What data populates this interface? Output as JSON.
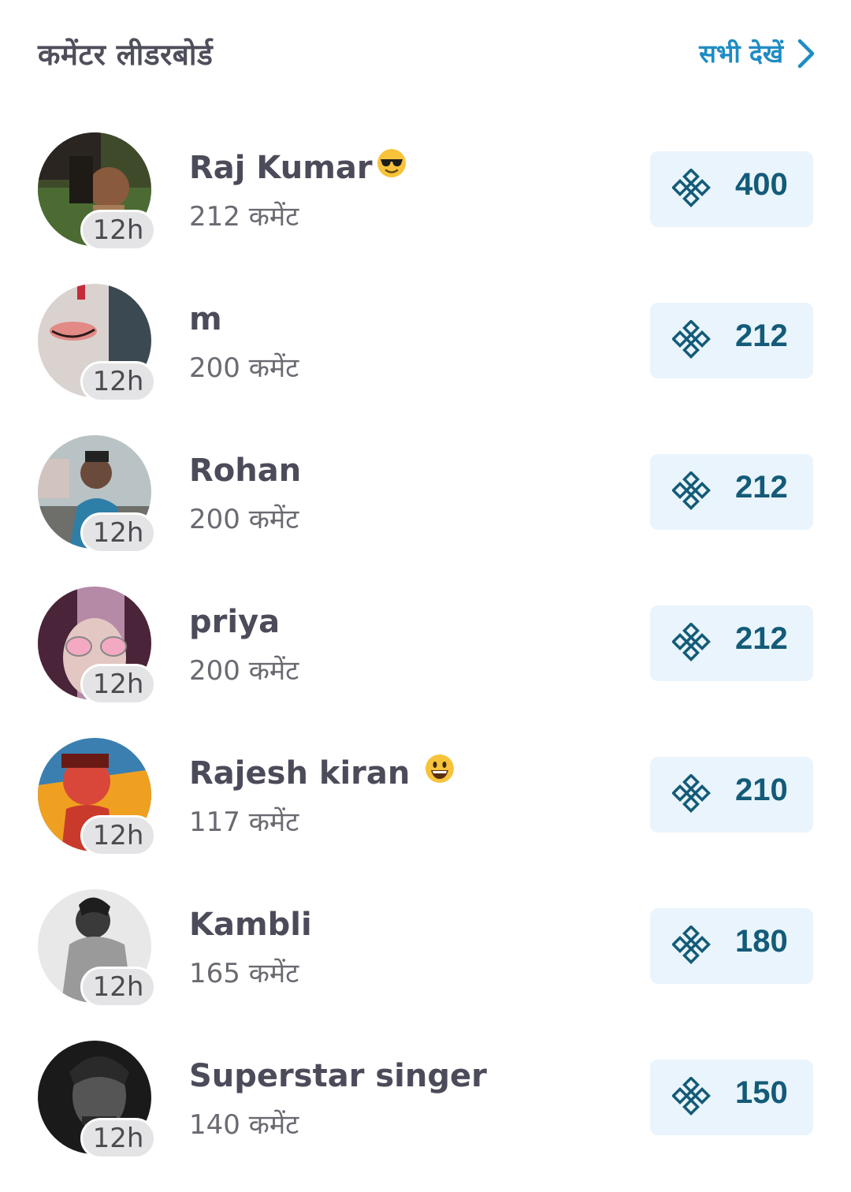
{
  "header": {
    "title": "कमेंटर लीडरबोर्ड",
    "see_all_label": "सभी देखें"
  },
  "commenters": [
    {
      "name": "Raj Kumar",
      "emoji": "sunglasses-emoji",
      "comments": "212 कमेंट",
      "time": "12h",
      "score": "400"
    },
    {
      "name": "m",
      "comments": "200 कमेंट",
      "time": "12h",
      "score": "212"
    },
    {
      "name": "Rohan",
      "comments": "200 कमेंट",
      "time": "12h",
      "score": "212"
    },
    {
      "name": " priya",
      "comments": "200 कमेंट",
      "time": "12h",
      "score": "212"
    },
    {
      "name": "Rajesh kiran ",
      "emoji": "grinning-emoji",
      "comments": "117 कमेंट",
      "time": "12h",
      "score": "210"
    },
    {
      "name": "Kambli",
      "comments": "165 कमेंट",
      "time": "12h",
      "score": "180"
    },
    {
      "name": "Superstar singer",
      "comments": "140 कमेंट",
      "time": "12h",
      "score": "150"
    }
  ],
  "colors": {
    "accent": "#1e8cc4",
    "score_text": "#135b78",
    "score_bg": "#eaf4fc"
  }
}
